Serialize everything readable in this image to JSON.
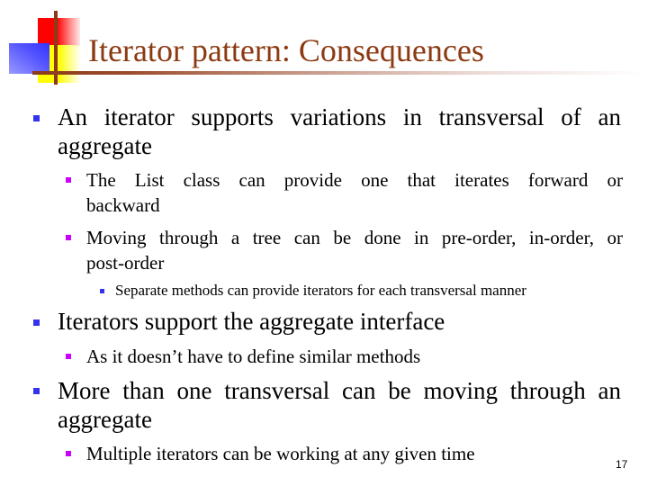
{
  "slide": {
    "title": "Iterator pattern: Consequences",
    "page_number": "17",
    "colors": {
      "title": "#8b3a12",
      "bullet_level1": "#3333ee",
      "bullet_level2": "#cc00ff",
      "bullet_level3": "#3333ee",
      "logo_red": "#ff0000",
      "logo_yellow": "#ffff00",
      "logo_blue": "#3333ff",
      "logo_line": "#8b3a1a"
    },
    "bullets": [
      {
        "level": 1,
        "text_line1": "An iterator supports variations in transversal of an",
        "text_line2": "aggregate",
        "children": [
          {
            "level": 2,
            "text_line1": "The List class can provide one that iterates forward or",
            "text_line2": "backward"
          },
          {
            "level": 2,
            "text_line1": "Moving through a tree can be done in pre-order, in-order, or",
            "text_line2": "post-order",
            "children": [
              {
                "level": 3,
                "text": "Separate methods can provide iterators for each transversal manner"
              }
            ]
          }
        ]
      },
      {
        "level": 1,
        "text": "Iterators support the aggregate interface",
        "children": [
          {
            "level": 2,
            "text": "As it doesn’t have to define similar methods"
          }
        ]
      },
      {
        "level": 1,
        "text_line1": "More than one transversal can be moving through an",
        "text_line2": "aggregate",
        "children": [
          {
            "level": 2,
            "text": "Multiple iterators can be working at any given time"
          }
        ]
      }
    ]
  }
}
